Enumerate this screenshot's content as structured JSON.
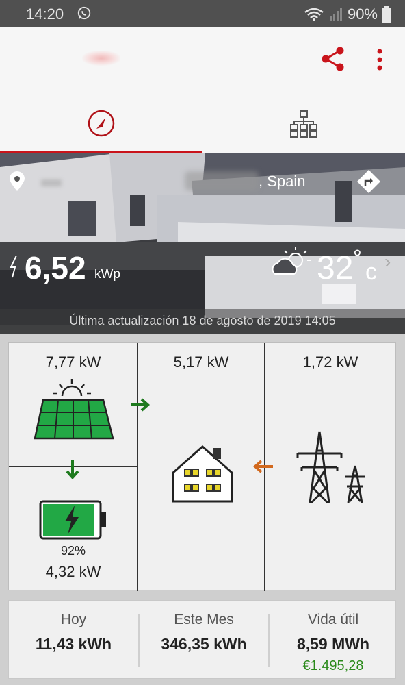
{
  "status_bar": {
    "time": "14:20",
    "battery": "90%"
  },
  "hero": {
    "location": ", Spain",
    "peak_power_value": "6,52",
    "peak_power_unit": "kWp",
    "temperature": "32",
    "temperature_degree": "°",
    "temperature_unit": "c",
    "chevron": "›",
    "last_update": "Última actualización 18 de agosto de 2019 14:05"
  },
  "flow": {
    "solar_power": "7,77 kW",
    "home_power": "5,17 kW",
    "grid_power": "1,72 kW",
    "battery_percent": "92%",
    "battery_power": "4,32 kW"
  },
  "stats": [
    {
      "label": "Hoy",
      "value": "11,43 kWh"
    },
    {
      "label": "Este Mes",
      "value": "346,35 kWh"
    },
    {
      "label": "Vida útil",
      "value": "8,59 MWh",
      "money": "€1.495,28"
    }
  ],
  "colors": {
    "accent": "#c9141b",
    "solar_green": "#22a845",
    "arrow_green": "#1e7a1e",
    "arrow_orange": "#d2691e",
    "money_green": "#2a8a1a"
  }
}
